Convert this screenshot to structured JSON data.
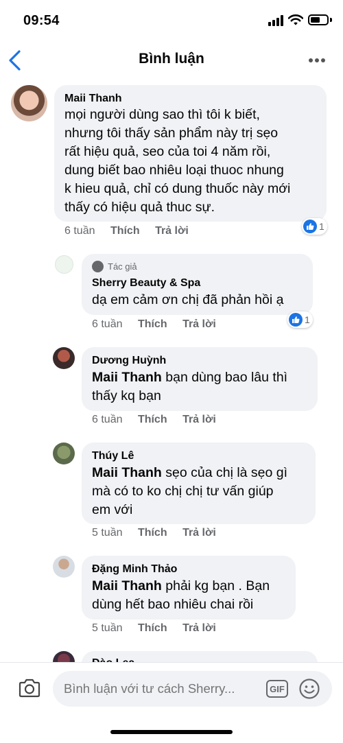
{
  "status_bar": {
    "time": "09:54"
  },
  "header": {
    "title": "Bình luận"
  },
  "comments": [
    {
      "name": "Maii Thanh",
      "lines": [
        "mọi người dùng sao thì tôi k biết,",
        "nhưng tôi thấy sản phẩm này trị sẹo",
        "rất hiệu quả, seo của toi 4 năm rồi,",
        "dung biết bao nhiêu loại thuoc nhung",
        "k hieu quả, chỉ có dung thuốc này mới",
        "thấy có hiệu quả thuc sự."
      ],
      "time": "6 tuần",
      "like": "Thích",
      "reply": "Trả lời",
      "reaction_count": "1"
    },
    {
      "author_badge": "Tác giả",
      "name": "Sherry Beauty & Spa",
      "lines": [
        "dạ em cảm ơn chị đã phản hồi ạ"
      ],
      "time": "6 tuần",
      "like": "Thích",
      "reply": "Trả lời",
      "reaction_count": "1"
    },
    {
      "name": "Dương Huỳnh",
      "mention": "Maii Thanh",
      "lines": [
        " bạn dùng bao lâu thì",
        "thấy kq bạn"
      ],
      "time": "6 tuần",
      "like": "Thích",
      "reply": "Trả lời"
    },
    {
      "name": "Thúy Lê",
      "mention": "Maii Thanh",
      "lines": [
        " sẹo của chị là sẹo gì",
        "mà có to ko chị  chị tư vấn giúp",
        "em với"
      ],
      "time": "5 tuần",
      "like": "Thích",
      "reply": "Trả lời"
    },
    {
      "name": "Đặng Minh Thảo",
      "mention": "Maii Thanh",
      "lines": [
        " phải kg bạn . Bạn",
        "dùng hết bao nhiêu chai rồi"
      ],
      "time": "5 tuần",
      "like": "Thích",
      "reply": "Trả lời"
    },
    {
      "name": "Đào Lea"
    }
  ],
  "composer": {
    "placeholder": "Bình luận với tư cách Sherry...",
    "gif_label": "GIF"
  },
  "icons": {
    "back": "chevron-left-icon",
    "more": "more-horizontal-icon",
    "camera": "camera-icon",
    "emoji": "emoji-icon",
    "like": "like-icon"
  },
  "colors": {
    "accent": "#1b74e4",
    "bubble": "#f0f2f5",
    "secondary_text": "#65676b"
  }
}
